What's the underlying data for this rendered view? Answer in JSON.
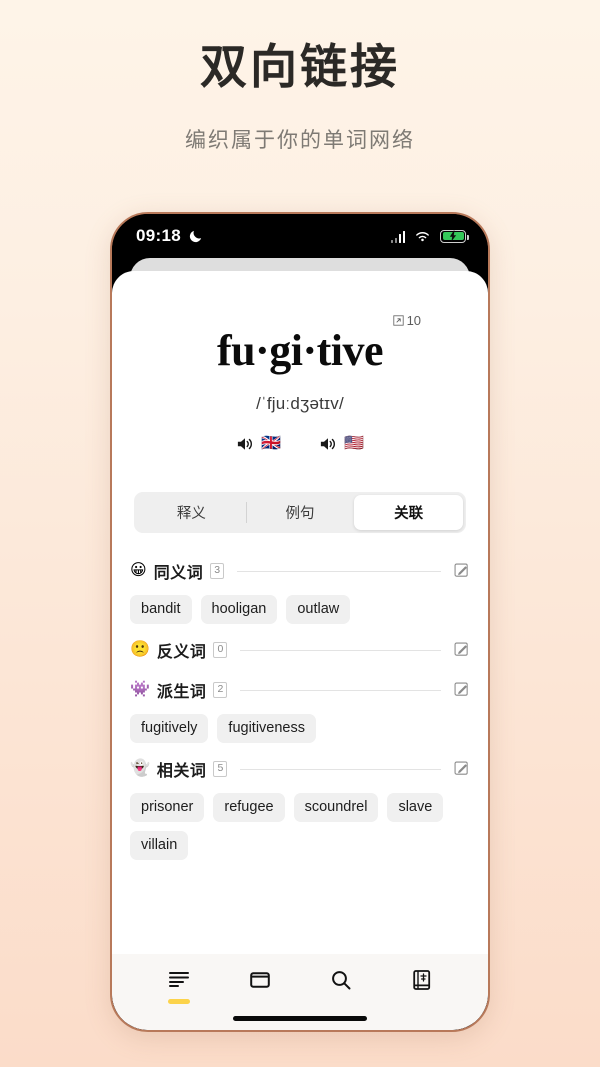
{
  "promo": {
    "title": "双向链接",
    "subtitle": "编织属于你的单词网络"
  },
  "colors": {
    "bg_top": "#FEF4E8",
    "bg_bottom": "#FBDCC9",
    "accent_yellow": "#FCD34A",
    "battery_green": "#34C759",
    "chip_bg": "#F0F0F0",
    "phone_border": "#B8795A"
  },
  "phone": {
    "statusbar": {
      "time": "09:18",
      "dnd_icon": "moon-icon",
      "signal_icon": "signal-bars-icon",
      "wifi_icon": "wifi-icon",
      "battery_icon": "battery-charging-icon"
    },
    "word": {
      "headword": "fu·gi·tive",
      "link_count": "10",
      "link_icon": "external-link-icon",
      "phonetic": "/ˈfjuːdʒətɪv/",
      "audio": [
        {
          "icon": "speaker-icon",
          "flag": "🇬🇧",
          "name": "uk"
        },
        {
          "icon": "speaker-icon",
          "flag": "🇺🇸",
          "name": "us"
        }
      ]
    },
    "tabs": [
      {
        "label": "释义",
        "active": false
      },
      {
        "label": "例句",
        "active": false
      },
      {
        "label": "关联",
        "active": true
      }
    ],
    "relations": [
      {
        "emoji": "😀",
        "emoji_name": "grinning-face-icon",
        "title": "同义词",
        "count": "3",
        "edit_icon": "edit-icon",
        "words": [
          "bandit",
          "hooligan",
          "outlaw"
        ]
      },
      {
        "emoji": "🙁",
        "emoji_name": "frowning-face-icon",
        "title": "反义词",
        "count": "0",
        "edit_icon": "edit-icon",
        "words": []
      },
      {
        "emoji": "👾",
        "emoji_name": "alien-monster-icon",
        "title": "派生词",
        "count": "2",
        "edit_icon": "edit-icon",
        "words": [
          "fugitively",
          "fugitiveness"
        ]
      },
      {
        "emoji": "👻",
        "emoji_name": "ghost-icon",
        "title": "相关词",
        "count": "5",
        "edit_icon": "edit-icon",
        "words": [
          "prisoner",
          "refugee",
          "scoundrel",
          "slave",
          "villain"
        ]
      }
    ],
    "bottom_nav": [
      {
        "icon": "list-lines-icon",
        "active": true
      },
      {
        "icon": "card-square-icon",
        "active": false
      },
      {
        "icon": "search-icon",
        "active": false
      },
      {
        "icon": "dictionary-book-icon",
        "active": false
      }
    ]
  }
}
